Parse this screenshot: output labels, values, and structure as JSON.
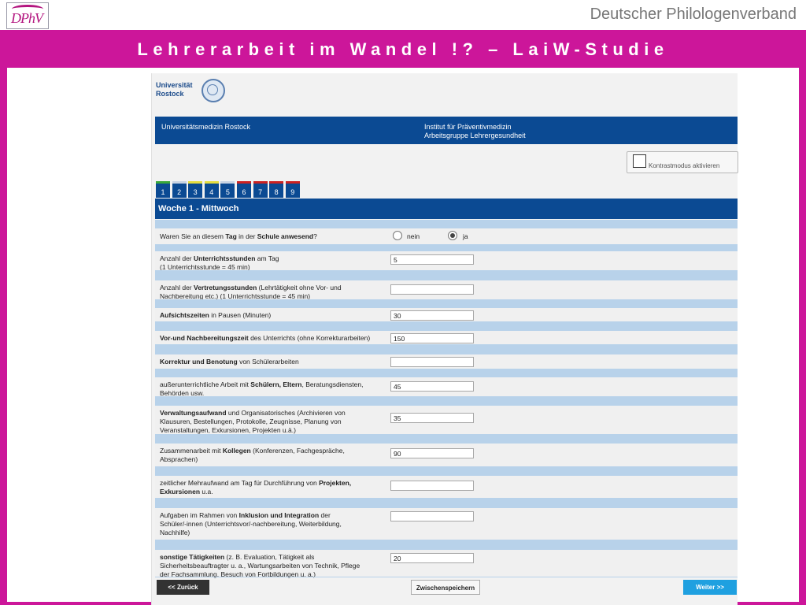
{
  "slide": {
    "logo_text": "DPhV",
    "org": "Deutscher Philologenverband",
    "title": "Lehrerarbeit im Wandel !? – LaiW-Studie"
  },
  "survey": {
    "university": [
      "Universität",
      "Rostock"
    ],
    "header_left": "Universitätsmedizin Rostock",
    "header_right": [
      "Institut für Präventivmedizin",
      "Arbeitsgruppe Lehrergesundheit"
    ],
    "contrast_label": "Kontrastmodus aktivieren",
    "days": [
      {
        "num": "1",
        "color": "#3aa83a"
      },
      {
        "num": "2",
        "color": "#c9d4e3"
      },
      {
        "num": "3",
        "color": "#e5dd40"
      },
      {
        "num": "4",
        "color": "#e5dd40"
      },
      {
        "num": "5",
        "color": "#c9d4e3"
      },
      {
        "num": "6",
        "color": "#cc2222"
      },
      {
        "num": "7",
        "color": "#cc2222"
      },
      {
        "num": "8",
        "color": "#cc2222"
      },
      {
        "num": "9",
        "color": "#cc2222"
      }
    ],
    "week_title": "Woche 1 - Mittwoch",
    "attendance": {
      "question_parts": [
        "Waren Sie an diesem ",
        "Tag",
        " in der ",
        "Schule anwesend",
        "?"
      ],
      "no": "nein",
      "yes": "ja",
      "selected": "ja"
    },
    "questions": [
      {
        "parts": [
          [
            "Anzahl der ",
            false
          ],
          [
            "Unterrichtsstunden",
            true
          ],
          [
            " am Tag",
            false
          ]
        ],
        "line2": "(1 Unterrichtsstunde = 45 min)",
        "value": "5"
      },
      {
        "parts": [
          [
            "Anzahl der ",
            false
          ],
          [
            "Vertretungsstunden",
            true
          ],
          [
            " (Lehrtätigkeit ohne Vor- und",
            false
          ]
        ],
        "line2": "Nachbereitung etc.) (1 Unterrichtsstunde = 45 min)",
        "value": ""
      },
      {
        "parts": [
          [
            "Aufsichtszeiten",
            true
          ],
          [
            " in Pausen (Minuten)",
            false
          ]
        ],
        "line2": "",
        "value": "30"
      },
      {
        "parts": [
          [
            "Vor-und Nachbereitungszeit",
            true
          ],
          [
            " des Unterrichts (ohne Korrekturarbeiten)",
            false
          ]
        ],
        "line2": "",
        "value": "150"
      },
      {
        "parts": [
          [
            "Korrektur und Benotung",
            true
          ],
          [
            " von Schülerarbeiten",
            false
          ]
        ],
        "line2": "",
        "value": ""
      },
      {
        "parts": [
          [
            "außerunterrichtliche Arbeit mit ",
            false
          ],
          [
            "Schülern, Eltern",
            true
          ],
          [
            ", Beratungsdiensten,",
            false
          ]
        ],
        "line2": "Behörden usw.",
        "value": "45"
      },
      {
        "parts": [
          [
            "Verwaltungsaufwand",
            true
          ],
          [
            " und Organisatorisches (Archivieren von",
            false
          ]
        ],
        "line2": "Klausuren, Bestellungen, Protokolle, Zeugnisse, Planung von",
        "line3": "Veranstaltungen, Exkursionen, Projekten u.ä.)",
        "value": "35"
      },
      {
        "parts": [
          [
            "Zusammenarbeit mit ",
            false
          ],
          [
            "Kollegen",
            true
          ],
          [
            " (Konferenzen, Fachgespräche,",
            false
          ]
        ],
        "line2": "Absprachen)",
        "value": "90"
      },
      {
        "parts": [
          [
            "zeitlicher Mehraufwand am Tag für Durchführung von ",
            false
          ],
          [
            "Projekten,",
            true
          ]
        ],
        "line2b": [
          [
            "Exkursionen",
            true
          ],
          [
            " u.a.",
            false
          ]
        ],
        "value": ""
      },
      {
        "parts": [
          [
            "Aufgaben im Rahmen von ",
            false
          ],
          [
            "Inklusion und Integration",
            true
          ],
          [
            " der",
            false
          ]
        ],
        "line2": "Schüler/-innen (Unterrichtsvor/-nachbereitung, Weiterbildung,",
        "line3": "Nachhilfe)",
        "value": ""
      },
      {
        "parts": [
          [
            "sonstige Tätigkeiten",
            true
          ],
          [
            " (z. B. Evaluation, Tätigkeit als",
            false
          ]
        ],
        "line2": "Sicherheitsbeauftragter u. a., Wartungsarbeiten von Technik, Pflege",
        "line3": "der Fachsammlung, Besuch von Fortbildungen u. a.)",
        "value": "20"
      }
    ],
    "buttons": {
      "back": "<< Zurück",
      "save": "Zwischenspeichern",
      "next": "Weiter >>"
    }
  }
}
